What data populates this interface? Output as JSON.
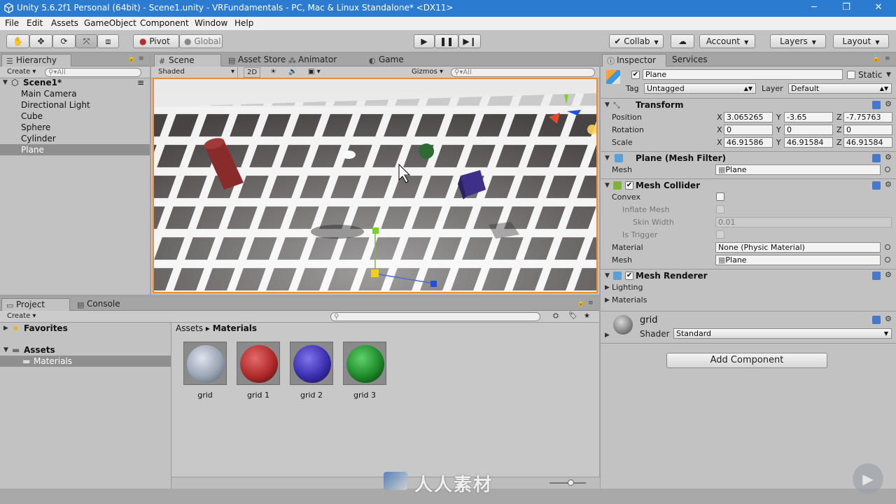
{
  "window": {
    "title": "Unity 5.6.2f1 Personal (64bit) - Scene1.unity - VRFundamentals - PC, Mac & Linux Standalone* <DX11>"
  },
  "menu": [
    "File",
    "Edit",
    "Assets",
    "GameObject",
    "Component",
    "Window",
    "Help"
  ],
  "toolbar": {
    "pivot": "Pivot",
    "global": "Global",
    "collab": "Collab",
    "account": "Account",
    "layers": "Layers",
    "layout": "Layout"
  },
  "hierarchy": {
    "tab": "Hierarchy",
    "create": "Create",
    "search_placeholder": "All",
    "scene": "Scene1*",
    "items": [
      "Main Camera",
      "Directional Light",
      "Cube",
      "Sphere",
      "Cylinder",
      "Plane"
    ],
    "selected": "Plane"
  },
  "scene_tabs": {
    "scene": "Scene",
    "asset_store": "Asset Store",
    "animator": "Animator",
    "game": "Game",
    "shaded": "Shaded",
    "two_d": "2D",
    "gizmos": "Gizmos",
    "search_placeholder": "All"
  },
  "project": {
    "tab": "Project",
    "console_tab": "Console",
    "create": "Create",
    "favorites": "Favorites",
    "assets": "Assets",
    "materials_folder": "Materials",
    "breadcrumb_root": "Assets",
    "breadcrumb_current": "Materials",
    "materials": [
      {
        "name": "grid",
        "color": "#9aa4b4"
      },
      {
        "name": "grid 1",
        "color": "#b02a2a"
      },
      {
        "name": "grid 2",
        "color": "#3a2fb0"
      },
      {
        "name": "grid 3",
        "color": "#1f8a2a"
      }
    ]
  },
  "inspector": {
    "tab": "Inspector",
    "services_tab": "Services",
    "object_name": "Plane",
    "static": "Static",
    "tag_label": "Tag",
    "tag_value": "Untagged",
    "layer_label": "Layer",
    "layer_value": "Default",
    "transform": {
      "title": "Transform",
      "position_label": "Position",
      "rotation_label": "Rotation",
      "scale_label": "Scale",
      "position": [
        "3.065265",
        "-3.65",
        "-7.75763"
      ],
      "rotation": [
        "0",
        "0",
        "0"
      ],
      "scale": [
        "46.91586",
        "46.91584",
        "46.91584"
      ]
    },
    "mesh_filter": {
      "title": "Plane (Mesh Filter)",
      "mesh_label": "Mesh",
      "mesh_value": "Plane"
    },
    "mesh_collider": {
      "title": "Mesh Collider",
      "convex": "Convex",
      "inflate_mesh": "Inflate Mesh",
      "skin_width": "Skin Width",
      "skin_width_value": "0.01",
      "is_trigger": "Is Trigger",
      "material_label": "Material",
      "material_value": "None (Physic Material)",
      "mesh_label": "Mesh",
      "mesh_value": "Plane"
    },
    "mesh_renderer": {
      "title": "Mesh Renderer",
      "lighting": "Lighting",
      "materials": "Materials"
    },
    "material": {
      "name": "grid",
      "shader_label": "Shader",
      "shader_value": "Standard"
    },
    "add_component": "Add Component"
  },
  "watermark": "人人素材"
}
